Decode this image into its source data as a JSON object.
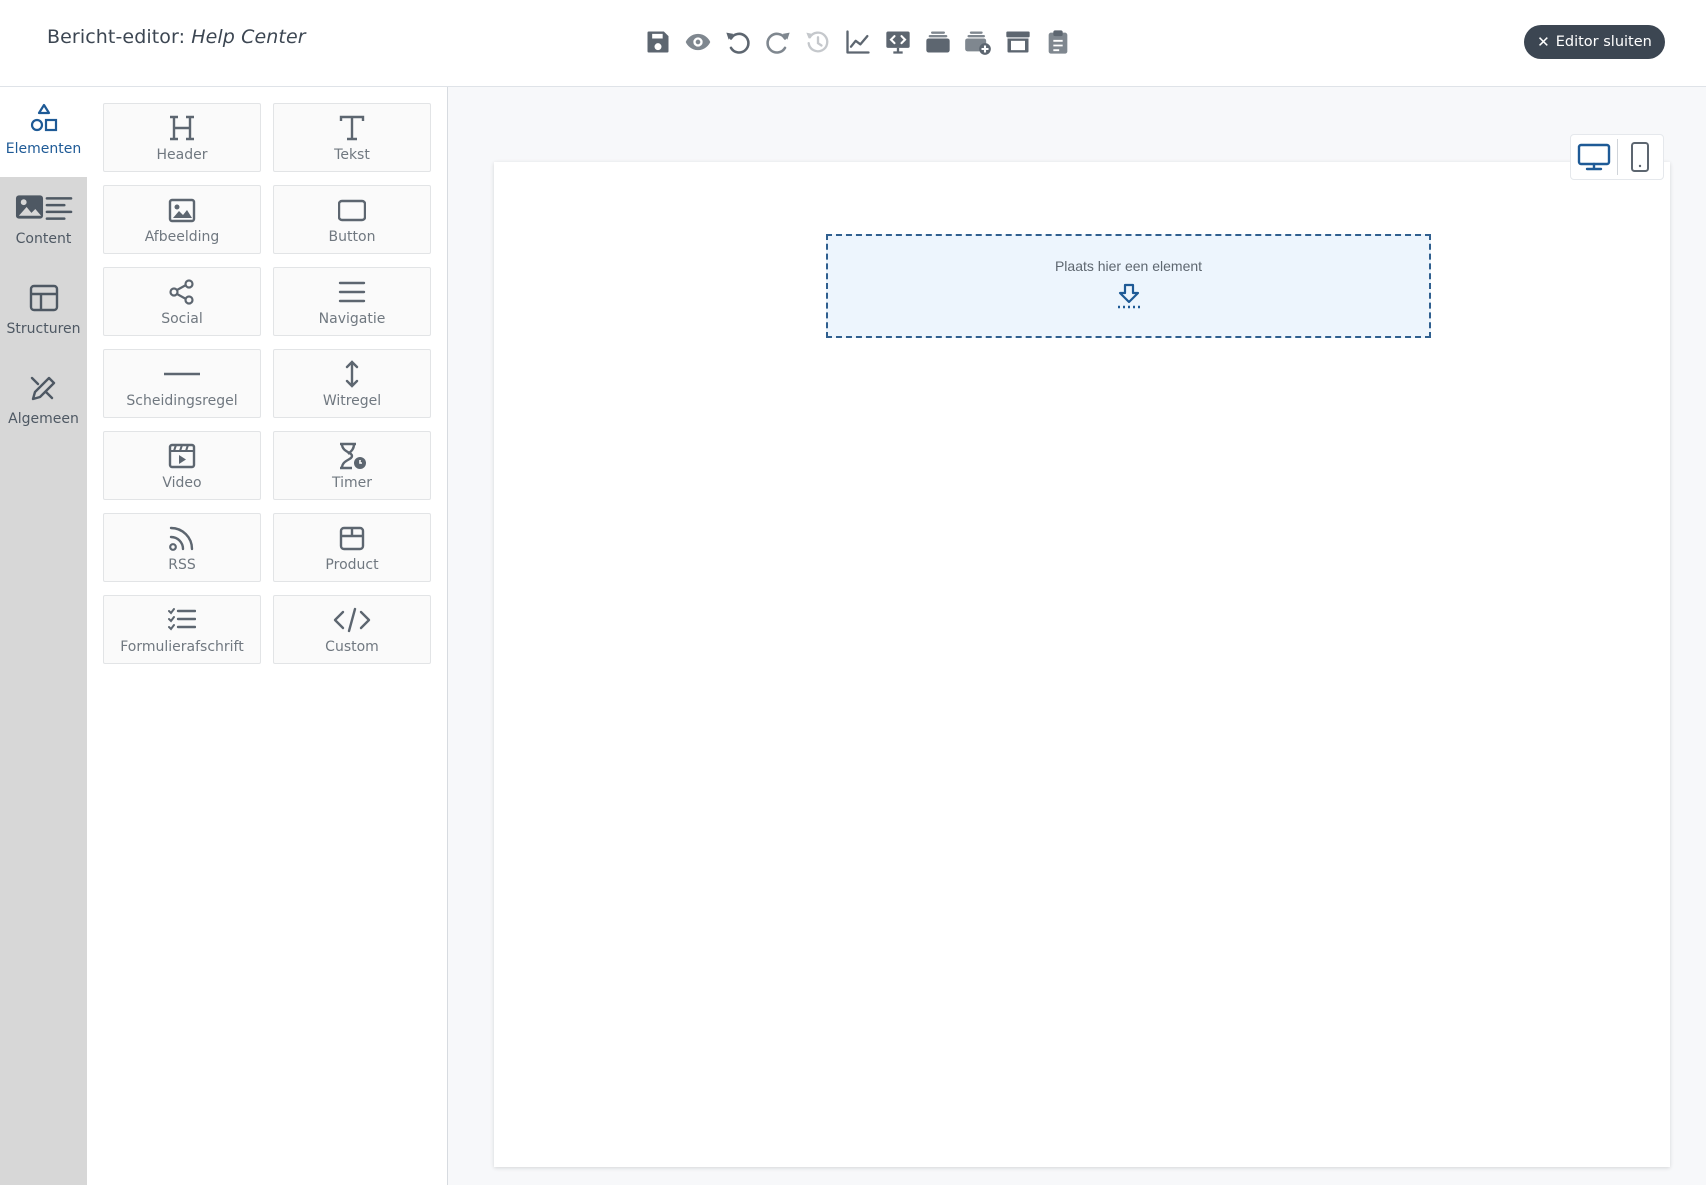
{
  "header": {
    "title_prefix": "Bericht-editor:",
    "document_name": "Help Center",
    "close_label": "Editor sluiten",
    "toolbar": [
      {
        "icon": "save-icon",
        "enabled": true
      },
      {
        "icon": "preview-eye-icon",
        "enabled": true
      },
      {
        "icon": "undo-icon",
        "enabled": true
      },
      {
        "icon": "redo-icon",
        "enabled": true
      },
      {
        "icon": "history-icon",
        "enabled": false
      },
      {
        "icon": "statistics-chart-icon",
        "enabled": true
      },
      {
        "icon": "code-view-icon",
        "enabled": true
      },
      {
        "icon": "templates-stack-icon",
        "enabled": true
      },
      {
        "icon": "add-template-icon",
        "enabled": true
      },
      {
        "icon": "archive-box-icon",
        "enabled": true
      },
      {
        "icon": "clipboard-checklist-icon",
        "enabled": true
      }
    ]
  },
  "rail": {
    "items": [
      {
        "label": "Elementen",
        "icon": "shapes-icon",
        "active": true
      },
      {
        "label": "Content",
        "icon": "image-text-icon",
        "active": false
      },
      {
        "label": "Structuren",
        "icon": "layout-icon",
        "active": false
      },
      {
        "label": "Algemeen",
        "icon": "edit-settings-icon",
        "active": false
      }
    ]
  },
  "palette": {
    "items": [
      {
        "label": "Header",
        "icon": "heading-icon"
      },
      {
        "label": "Tekst",
        "icon": "text-icon"
      },
      {
        "label": "Afbeelding",
        "icon": "image-icon"
      },
      {
        "label": "Button",
        "icon": "button-icon"
      },
      {
        "label": "Social",
        "icon": "share-icon"
      },
      {
        "label": "Navigatie",
        "icon": "menu-lines-icon"
      },
      {
        "label": "Scheidingsregel",
        "icon": "divider-icon"
      },
      {
        "label": "Witregel",
        "icon": "spacer-arrows-icon"
      },
      {
        "label": "Video",
        "icon": "video-icon"
      },
      {
        "label": "Timer",
        "icon": "hourglass-clock-icon"
      },
      {
        "label": "RSS",
        "icon": "rss-icon"
      },
      {
        "label": "Product",
        "icon": "product-box-icon"
      },
      {
        "label": "Formulierafschrift",
        "icon": "checklist-icon"
      },
      {
        "label": "Custom",
        "icon": "code-icon"
      }
    ]
  },
  "canvas": {
    "dropzone_text": "Plaats hier een element",
    "view_modes": [
      {
        "icon": "desktop-icon",
        "active": true
      },
      {
        "icon": "mobile-icon",
        "active": false
      }
    ]
  },
  "colors": {
    "accent": "#1e5a96",
    "close_button_bg": "#3c4652",
    "rail_bg": "#d7d7d7",
    "dropzone_bg": "#edf5fd"
  }
}
